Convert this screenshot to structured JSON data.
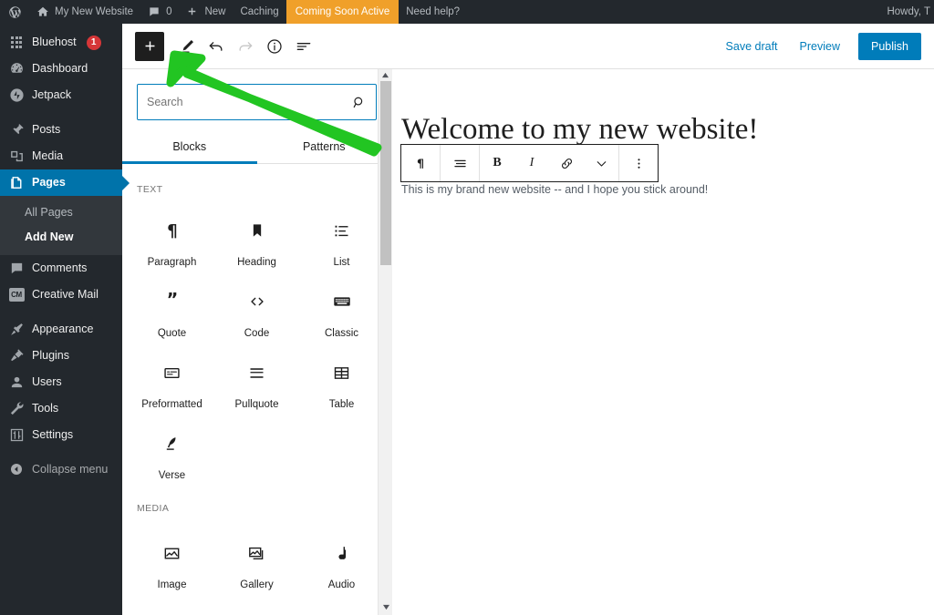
{
  "adminbar": {
    "site_title": "My New Website",
    "comments_count": "0",
    "new_label": "New",
    "caching_label": "Caching",
    "coming_soon_label": "Coming Soon Active",
    "help_label": "Need help?",
    "howdy_label": "Howdy, T",
    "background": "#23282d",
    "coming_soon_color": "#f0a02a"
  },
  "sidebar": {
    "items": [
      {
        "label": "Bluehost",
        "icon": "grid-icon",
        "badge": "1",
        "current": false
      },
      {
        "label": "Dashboard",
        "icon": "dashboard-icon",
        "current": false
      },
      {
        "label": "Jetpack",
        "icon": "jetpack-icon",
        "current": false
      },
      {
        "label": "Posts",
        "icon": "pin-icon",
        "current": false
      },
      {
        "label": "Media",
        "icon": "media-icon",
        "current": false
      },
      {
        "label": "Pages",
        "icon": "pages-icon",
        "current": true
      },
      {
        "label": "Comments",
        "icon": "comments-icon",
        "current": false
      },
      {
        "label": "Creative Mail",
        "icon": "creative-mail-icon",
        "current": false
      },
      {
        "label": "Appearance",
        "icon": "appearance-icon",
        "current": false
      },
      {
        "label": "Plugins",
        "icon": "plugins-icon",
        "current": false
      },
      {
        "label": "Users",
        "icon": "users-icon",
        "current": false
      },
      {
        "label": "Tools",
        "icon": "tools-icon",
        "current": false
      },
      {
        "label": "Settings",
        "icon": "settings-icon",
        "current": false
      },
      {
        "label": "Collapse menu",
        "icon": "collapse-icon",
        "current": false
      }
    ],
    "submenu": [
      {
        "label": "All Pages",
        "current": false
      },
      {
        "label": "Add New",
        "current": true
      }
    ],
    "active_color": "#0073aa",
    "badge_color": "#d63638"
  },
  "editor_header": {
    "add_block_label": "+",
    "tools": [
      "edit-pen-icon",
      "undo-icon",
      "redo-icon",
      "info-icon",
      "list-view-icon"
    ],
    "save_draft_label": "Save draft",
    "preview_label": "Preview",
    "publish_label": "Publish",
    "link_color": "#007cba",
    "publish_bg": "#007cba"
  },
  "inserter": {
    "search_placeholder": "Search",
    "search_value": "",
    "tabs": [
      {
        "label": "Blocks",
        "active": true
      },
      {
        "label": "Patterns",
        "active": false
      }
    ],
    "sections": [
      {
        "label": "TEXT",
        "blocks": [
          {
            "label": "Paragraph",
            "icon": "paragraph-icon"
          },
          {
            "label": "Heading",
            "icon": "heading-icon"
          },
          {
            "label": "List",
            "icon": "list-icon"
          },
          {
            "label": "Quote",
            "icon": "quote-icon"
          },
          {
            "label": "Code",
            "icon": "code-icon"
          },
          {
            "label": "Classic",
            "icon": "classic-icon"
          },
          {
            "label": "Preformatted",
            "icon": "preformatted-icon"
          },
          {
            "label": "Pullquote",
            "icon": "pullquote-icon"
          },
          {
            "label": "Table",
            "icon": "table-icon"
          },
          {
            "label": "Verse",
            "icon": "verse-icon"
          }
        ]
      },
      {
        "label": "MEDIA",
        "blocks": [
          {
            "label": "Image",
            "icon": "image-icon"
          },
          {
            "label": "Gallery",
            "icon": "gallery-icon"
          },
          {
            "label": "Audio",
            "icon": "audio-icon"
          }
        ]
      }
    ]
  },
  "content": {
    "title": "Welcome to my new website!",
    "paragraph": "This is my brand new website -- and I hope you stick around!"
  },
  "block_toolbar": {
    "buttons": [
      "paragraph-type-icon",
      "align-icon",
      "bold-icon",
      "italic-icon",
      "link-icon",
      "chevron-down-icon",
      "more-options-icon"
    ],
    "bold_label": "B",
    "italic_label": "I"
  },
  "annotation": {
    "arrow_color": "#22c522"
  }
}
